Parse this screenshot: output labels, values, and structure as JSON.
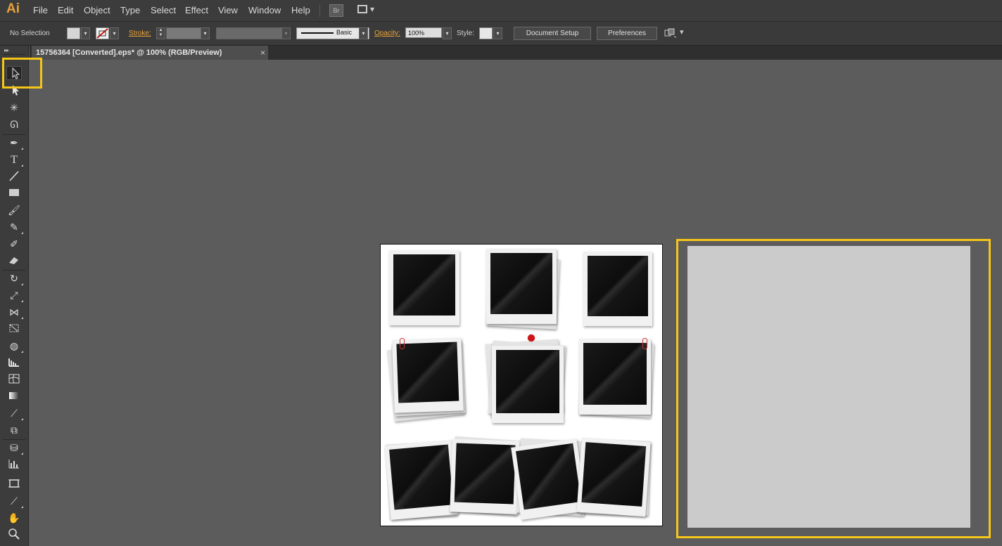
{
  "app": {
    "logo": "Ai"
  },
  "menu": {
    "items": [
      "File",
      "Edit",
      "Object",
      "Type",
      "Select",
      "Effect",
      "View",
      "Window",
      "Help"
    ],
    "bridge": "Br"
  },
  "control_bar": {
    "selection_label": "No Selection",
    "stroke_label": "Stroke:",
    "brush_style": "Basic",
    "opacity_label": "Opacity:",
    "opacity_value": "100%",
    "style_label": "Style:",
    "document_setup": "Document Setup",
    "preferences": "Preferences"
  },
  "document_tab": {
    "title": "15756364 [Converted].eps* @ 100% (RGB/Preview)",
    "close": "×"
  },
  "toolbar": {
    "expand": "▸▸",
    "tools": [
      "selection-tool",
      "direct-selection-tool",
      "magic-wand-tool",
      "lasso-tool",
      "pen-tool",
      "type-tool",
      "line-segment-tool",
      "rectangle-tool",
      "paintbrush-tool",
      "pencil-tool",
      "blob-brush-tool",
      "eraser-tool",
      "rotate-tool",
      "scale-tool",
      "width-tool",
      "free-transform-tool",
      "shape-builder-tool",
      "perspective-grid-tool",
      "mesh-tool",
      "gradient-tool",
      "eyedropper-tool",
      "blend-tool",
      "symbol-sprayer-tool",
      "column-graph-tool",
      "artboard-tool",
      "slice-tool",
      "hand-tool",
      "zoom-tool"
    ],
    "active_tool": "selection-tool"
  },
  "colors": {
    "highlight": "#f5c518",
    "accent": "#e8a33a",
    "canvas": "#5c5c5c",
    "preview_fill": "#cbcbcb"
  }
}
